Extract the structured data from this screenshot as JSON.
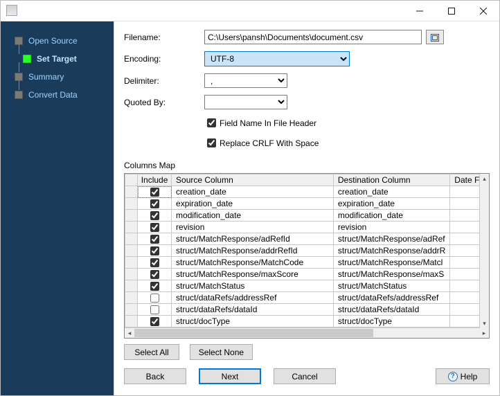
{
  "window": {
    "title": ""
  },
  "sidebar": {
    "items": [
      {
        "label": "Open Source",
        "active": false
      },
      {
        "label": "Set Target",
        "active": true
      },
      {
        "label": "Summary",
        "active": false
      },
      {
        "label": "Convert Data",
        "active": false
      }
    ]
  },
  "form": {
    "filename_label": "Filename:",
    "filename_value": "C:\\Users\\pansh\\Documents\\document.csv",
    "encoding_label": "Encoding:",
    "encoding_value": "UTF-8",
    "delimiter_label": "Delimiter:",
    "delimiter_value": ",",
    "quoted_label": "Quoted By:",
    "quoted_value": "",
    "field_header_label": "Field Name In File Header",
    "field_header_checked": true,
    "replace_crlf_label": "Replace CRLF With Space",
    "replace_crlf_checked": true
  },
  "columns_map": {
    "section_label": "Columns Map",
    "headers": {
      "include": "Include",
      "source": "Source Column",
      "destination": "Destination Column",
      "date_format": "Date Fo"
    },
    "rows": [
      {
        "include": true,
        "source": "creation_date",
        "destination": "creation_date"
      },
      {
        "include": true,
        "source": "expiration_date",
        "destination": "expiration_date"
      },
      {
        "include": true,
        "source": "modification_date",
        "destination": "modification_date"
      },
      {
        "include": true,
        "source": "revision",
        "destination": "revision"
      },
      {
        "include": true,
        "source": "struct/MatchResponse/adRefId",
        "destination": "struct/MatchResponse/adRef"
      },
      {
        "include": true,
        "source": "struct/MatchResponse/addrRefId",
        "destination": "struct/MatchResponse/addrR"
      },
      {
        "include": true,
        "source": "struct/MatchResponse/MatchCode",
        "destination": "struct/MatchResponse/Matcl"
      },
      {
        "include": true,
        "source": "struct/MatchResponse/maxScore",
        "destination": "struct/MatchResponse/maxS"
      },
      {
        "include": true,
        "source": "struct/MatchStatus",
        "destination": "struct/MatchStatus"
      },
      {
        "include": false,
        "source": "struct/dataRefs/addressRef",
        "destination": "struct/dataRefs/addressRef"
      },
      {
        "include": false,
        "source": "struct/dataRefs/dataId",
        "destination": "struct/dataRefs/dataId"
      },
      {
        "include": true,
        "source": "struct/docType",
        "destination": "struct/docType"
      }
    ]
  },
  "buttons": {
    "select_all": "Select All",
    "select_none": "Select None",
    "back": "Back",
    "next": "Next",
    "cancel": "Cancel",
    "help": "Help"
  }
}
